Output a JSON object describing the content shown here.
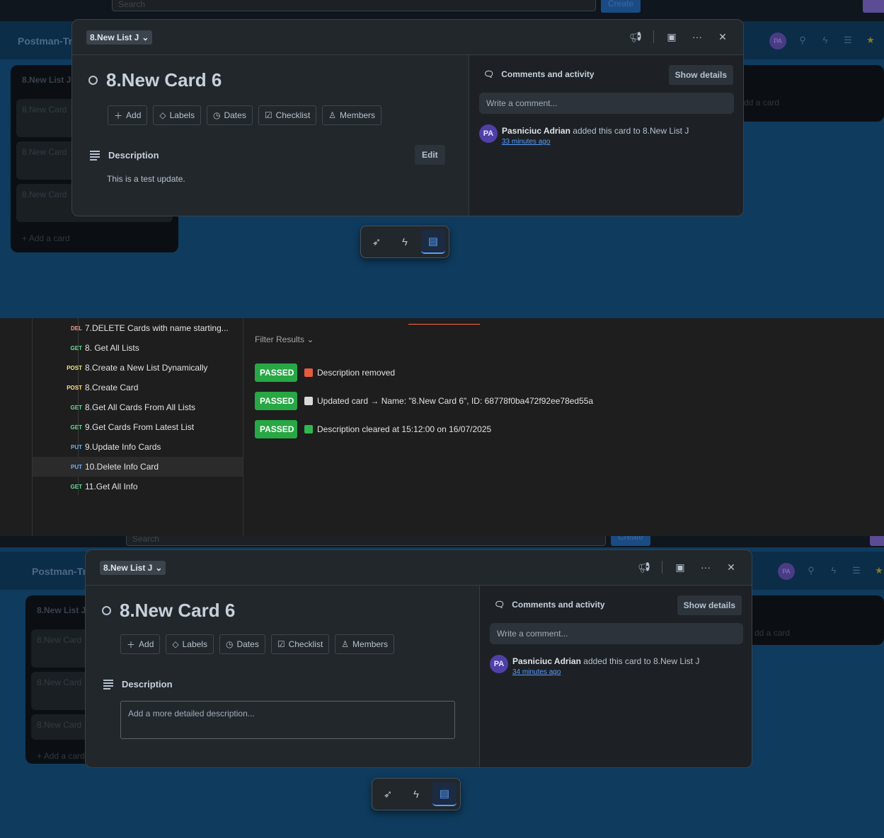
{
  "modal": {
    "list_name": "8.New List J",
    "card_title": "8.New Card 6",
    "actions": [
      "Add",
      "Labels",
      "Dates",
      "Checklist",
      "Members"
    ],
    "description_label": "Description",
    "edit_label": "Edit",
    "comments_label": "Comments and activity",
    "show_details_label": "Show details",
    "comment_placeholder": "Write a comment...",
    "activity_user": "Pasniciuc Adrian",
    "activity_initials": "PA",
    "activity_text": "added this card to 8.New List J"
  },
  "top_modal": {
    "description_text": "This is a test update.",
    "activity_time": "33 minutes ago"
  },
  "bottom_modal": {
    "description_placeholder": "Add a more detailed description...",
    "activity_time": "34 minutes ago"
  },
  "board": {
    "top_search": "Search",
    "create_label": "Create",
    "board_title": "Postman-Tr",
    "list_title": "8.New List J",
    "ghost_cards": [
      "8.New Card",
      "8.New Card",
      "8.New Card"
    ],
    "add_card": "Add a card",
    "right_add_card": "dd a card"
  },
  "postman": {
    "requests": [
      {
        "method": "DEL",
        "name": "7.DELETE Cards with name starting..."
      },
      {
        "method": "GET",
        "name": "8. Get All Lists"
      },
      {
        "method": "POST",
        "name": "8.Create a New List Dynamically"
      },
      {
        "method": "POST",
        "name": "8.Create Card"
      },
      {
        "method": "GET",
        "name": "8.Get All Cards From All Lists"
      },
      {
        "method": "GET",
        "name": "9.Get Cards From Latest List"
      },
      {
        "method": "PUT",
        "name": "9.Update Info Cards"
      },
      {
        "method": "PUT",
        "name": "10.Delete Info Card"
      },
      {
        "method": "GET",
        "name": "11.Get All Info"
      }
    ],
    "filter_label": "Filter Results",
    "results": [
      {
        "status": "PASSED",
        "text": "Description removed",
        "emoji_color": "#e45b3f"
      },
      {
        "status": "PASSED",
        "text": "Updated card → Name: \"8.New Card 6\", ID: 68778f0ba472f92ee78ed55a",
        "emoji_color": "#d9d9d9"
      },
      {
        "status": "PASSED",
        "text": "Description cleared at 15:12:00 on 16/07/2025",
        "emoji_color": "#2fb84f"
      }
    ]
  },
  "colors": {
    "passed": "#28a745",
    "accent": "#579dff",
    "board_bg": "#0f3b5e"
  },
  "icons": [
    "megaphone-icon",
    "image-icon",
    "ellipsis-icon",
    "close-icon",
    "rocket-icon",
    "bolt-icon",
    "comment-icon",
    "plus-icon",
    "tag-icon",
    "clock-icon",
    "checklist-icon",
    "member-icon",
    "description-icon"
  ]
}
